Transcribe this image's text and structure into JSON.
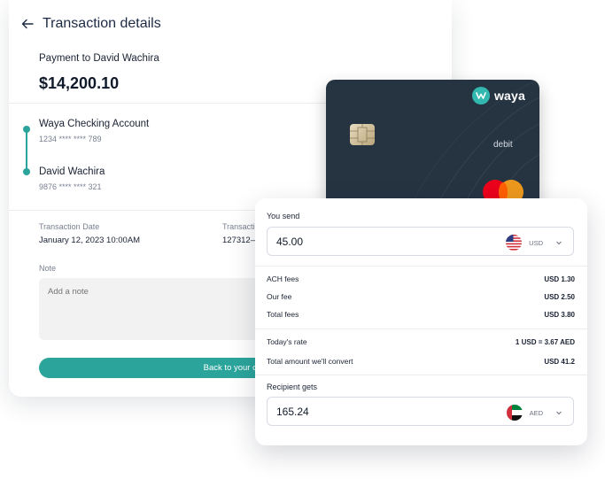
{
  "transaction": {
    "title": "Transaction details",
    "payee_line": "Payment to David Wachira",
    "amount": "$14,200.10",
    "from": {
      "name": "Waya Checking Account",
      "account": "1234 **** **** 789"
    },
    "to": {
      "name": "David Wachira",
      "account": "9876 **** **** 321"
    },
    "date_label": "Transaction Date",
    "date_value": "January 12, 2023 10:00AM",
    "id_label": "Transacti",
    "id_value": "127312–28",
    "note_label": "Note",
    "note_placeholder": "Add a note",
    "cta_label": "Back to your car"
  },
  "card": {
    "brand": "waya",
    "type": "debit",
    "colors": {
      "card": "#263442",
      "accent": "#33b8b0"
    }
  },
  "converter": {
    "send_label": "You send",
    "send_amount": "45.00",
    "send_currency": "USD",
    "fees": [
      {
        "label": "ACH fees",
        "value": "USD 1.30"
      },
      {
        "label": "Our fee",
        "value": "USD 2.50"
      },
      {
        "label": "Total fees",
        "value": "USD 3.80"
      }
    ],
    "rate_label": "Today's rate",
    "rate_value": "1 USD = 3.67 AED",
    "convert_label": "Total amount we'll convert",
    "convert_value": "USD 41.2",
    "receive_label": "Recipient gets",
    "receive_amount": "165.24",
    "receive_currency": "AED"
  },
  "colors": {
    "accent": "#2ba59c",
    "text": "#1a2233",
    "muted": "#7a8091"
  }
}
